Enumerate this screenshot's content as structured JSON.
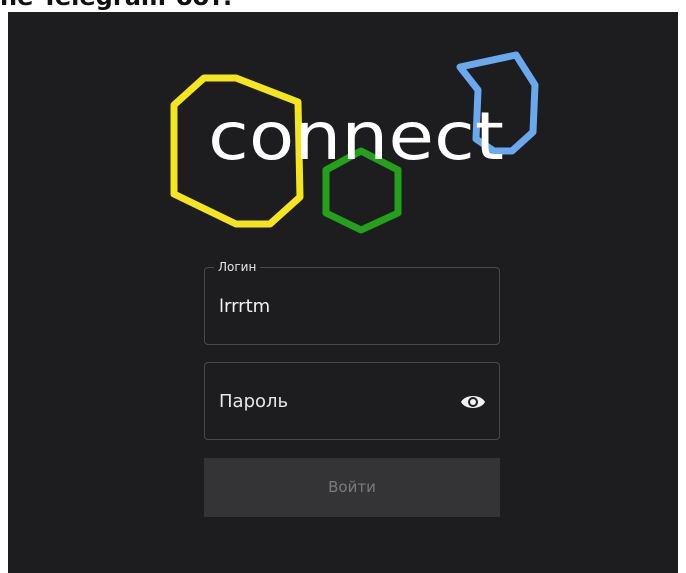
{
  "caption": "he Telegram-бот.",
  "logo": {
    "wordmark": "connect",
    "colors": {
      "yellow": "#f4e51c",
      "green": "#23a11a",
      "blue": "#6aa9ee",
      "text": "#ffffff"
    }
  },
  "login_field": {
    "legend": "Логин",
    "value": "lrrrtm"
  },
  "password_field": {
    "placeholder": "Пароль",
    "icon": "eye-icon"
  },
  "submit": {
    "label": "Войти"
  },
  "colors": {
    "background": "#1d1d1f",
    "field_border": "#4a4a4d",
    "button_bg": "#343436",
    "button_text": "#7b7b7e"
  }
}
